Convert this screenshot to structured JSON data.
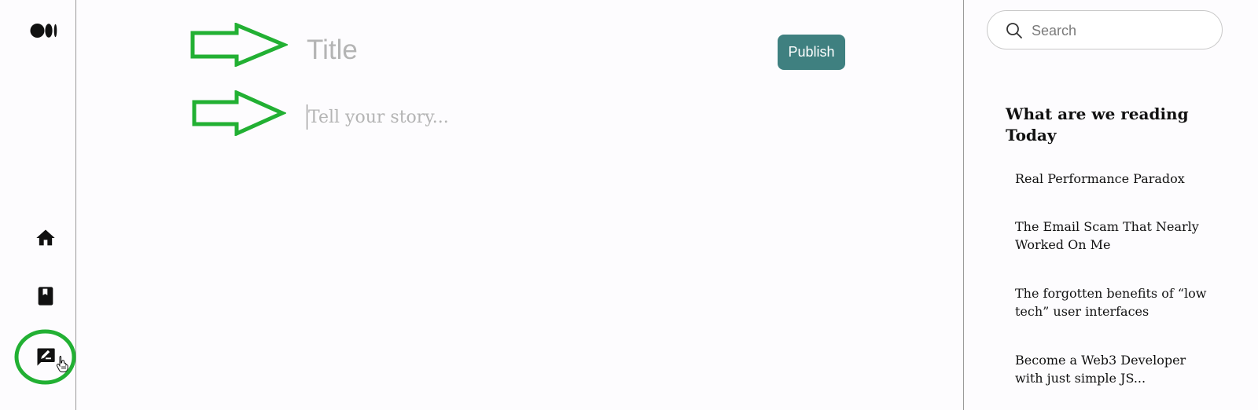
{
  "editor": {
    "title_placeholder": "Title",
    "story_placeholder": "Tell your story...",
    "publish_label": "Publish"
  },
  "nav": {
    "logo": "medium-logo",
    "items": [
      "home-icon",
      "library-icon",
      "write-icon"
    ]
  },
  "sidebar": {
    "search_placeholder": "Search",
    "heading": "What are we reading Today",
    "articles": [
      "Real Performance Paradox",
      "The Email Scam That Nearly Worked On Me",
      "The forgotten benefits of “low tech” user interfaces",
      "Become a Web3 Developer with just simple JS..."
    ]
  },
  "colors": {
    "accent": "#3f8080",
    "annotation": "#22b033",
    "placeholder": "#b4b4b4"
  }
}
